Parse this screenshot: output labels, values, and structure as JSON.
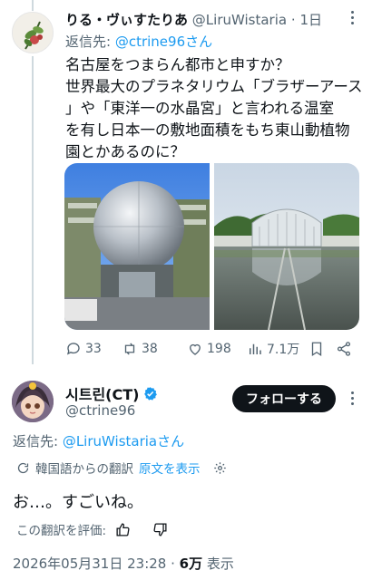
{
  "reply_tweet": {
    "display_name": "りる・ヴぃすたりあ",
    "handle": "@LiruWistaria",
    "separator": "·",
    "time": "1日",
    "reply_to_prefix": "返信先: ",
    "reply_to_mention": "@ctrine96さん",
    "text_lines": [
      "名古屋をつまらん都市と申すか？",
      "世界最大のプラネタリウム「ブラザーアース",
      "」や「東洋一の水晶宮」と言われる温室",
      "を有し日本一の敷地面積をもち東山動植物",
      "園とかあるのに？"
    ],
    "stats": {
      "replies": "33",
      "retweets": "38",
      "likes": "198",
      "views": "7.1万"
    },
    "icons": [
      "more-icon",
      "reply-icon",
      "retweet-icon",
      "like-icon",
      "views-icon",
      "bookmark-icon",
      "share-icon"
    ]
  },
  "main_tweet": {
    "display_name": "시트린(CT)",
    "handle": "@ctrine96",
    "follow_label": "フォローする",
    "reply_to_prefix": "返信先: ",
    "reply_to_mention": "@LiruWistariaさん",
    "translated_from": "韓国語からの翻訳",
    "show_original": "原文を表示",
    "text": "お…。すごいね。",
    "rate_translation": "この翻訳を評価:",
    "timestamp": "2026年05月31日 23:28 · ",
    "views_count": "6万",
    "views_label": " 表示",
    "icons": [
      "verified-icon",
      "more-icon",
      "translate-icon",
      "gear-icon",
      "thumbs-up-icon",
      "thumbs-down-icon"
    ]
  },
  "colors": {
    "accent": "#1d9bf0",
    "text": "#0f1419",
    "secondary": "#536471",
    "button": "#0f1419"
  }
}
